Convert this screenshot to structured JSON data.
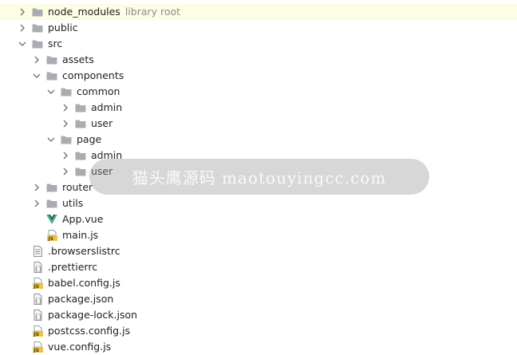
{
  "tree": {
    "items": [
      {
        "label": "node_modules",
        "sublabel": "library root",
        "icon": "folder-icon",
        "expand": "collapsed",
        "depth": 0,
        "highlight": true
      },
      {
        "label": "public",
        "icon": "folder-icon",
        "expand": "collapsed",
        "depth": 0
      },
      {
        "label": "src",
        "icon": "folder-icon",
        "expand": "expanded",
        "depth": 0
      },
      {
        "label": "assets",
        "icon": "folder-icon",
        "expand": "collapsed",
        "depth": 1
      },
      {
        "label": "components",
        "icon": "folder-icon",
        "expand": "expanded",
        "depth": 1
      },
      {
        "label": "common",
        "icon": "folder-icon",
        "expand": "expanded",
        "depth": 2
      },
      {
        "label": "admin",
        "icon": "folder-icon",
        "expand": "collapsed",
        "depth": 3
      },
      {
        "label": "user",
        "icon": "folder-icon",
        "expand": "collapsed",
        "depth": 3
      },
      {
        "label": "page",
        "icon": "folder-icon",
        "expand": "expanded",
        "depth": 2
      },
      {
        "label": "admin",
        "icon": "folder-icon",
        "expand": "collapsed",
        "depth": 3
      },
      {
        "label": "user",
        "icon": "folder-icon",
        "expand": "collapsed",
        "depth": 3
      },
      {
        "label": "router",
        "icon": "folder-icon",
        "expand": "collapsed",
        "depth": 1
      },
      {
        "label": "utils",
        "icon": "folder-icon",
        "expand": "collapsed",
        "depth": 1
      },
      {
        "label": "App.vue",
        "icon": "vue-file-icon",
        "expand": "none",
        "depth": 1
      },
      {
        "label": "main.js",
        "icon": "js-file-icon",
        "expand": "none",
        "depth": 1
      },
      {
        "label": ".browserslistrc",
        "icon": "text-file-icon",
        "expand": "none",
        "depth": 0
      },
      {
        "label": ".prettierrc",
        "icon": "config-file-icon",
        "expand": "none",
        "depth": 0
      },
      {
        "label": "babel.config.js",
        "icon": "js-file-icon",
        "expand": "none",
        "depth": 0
      },
      {
        "label": "package.json",
        "icon": "config-file-icon",
        "expand": "none",
        "depth": 0
      },
      {
        "label": "package-lock.json",
        "icon": "config-file-icon",
        "expand": "none",
        "depth": 0
      },
      {
        "label": "postcss.config.js",
        "icon": "js-file-icon",
        "expand": "none",
        "depth": 0
      },
      {
        "label": "vue.config.js",
        "icon": "js-file-icon",
        "expand": "none",
        "depth": 0
      }
    ]
  },
  "watermark": {
    "text": "猫头鹰源码 maotouyingcc.com"
  },
  "colors": {
    "folder": "#a8adb4",
    "vue_green": "#41b883",
    "vue_dark": "#35495e",
    "js_yellow": "#f0c23b",
    "highlight": "#fdfde4"
  }
}
